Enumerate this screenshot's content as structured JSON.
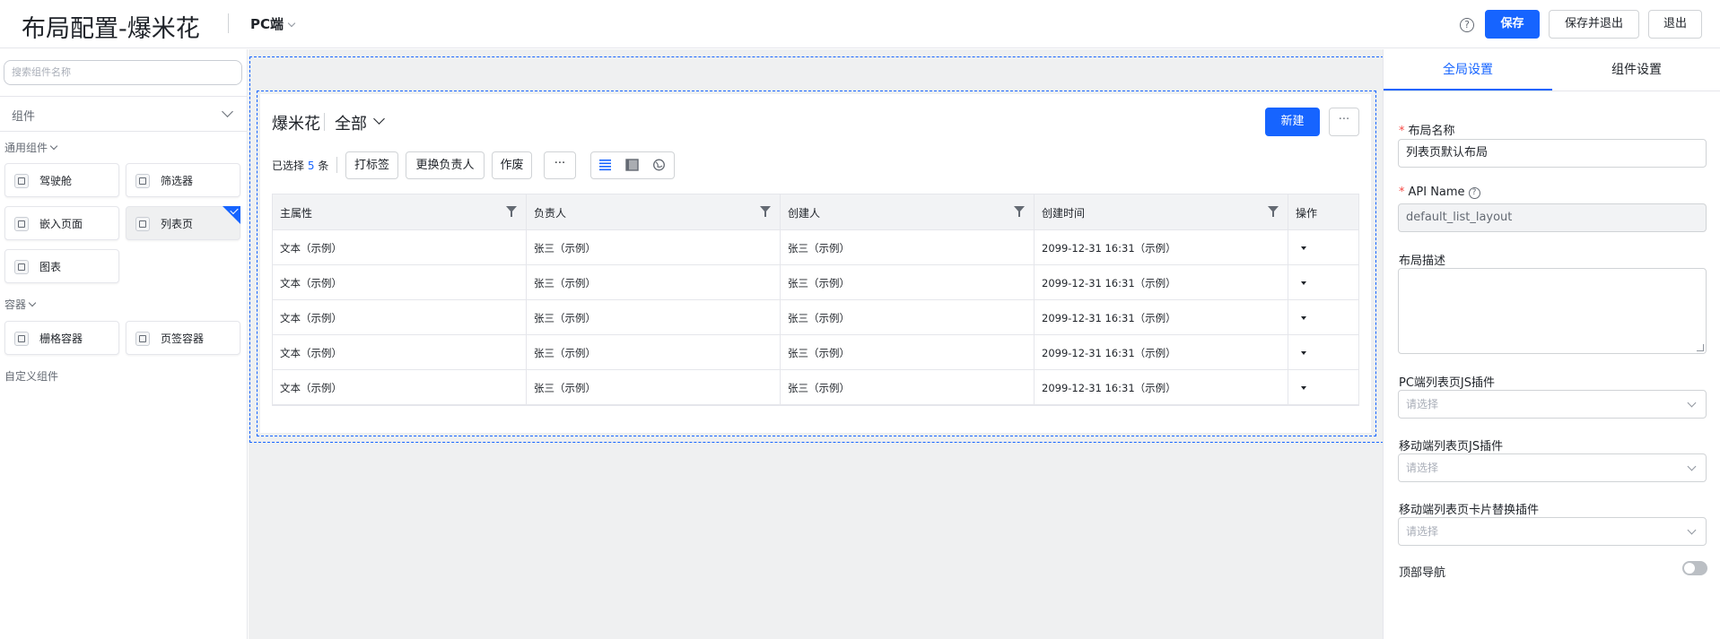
{
  "header": {
    "title": "布局配置-爆米花",
    "device": "PC端",
    "help_icon": "?",
    "save": "保存",
    "save_exit": "保存并退出",
    "exit": "退出"
  },
  "left": {
    "search_placeholder": "搜索组件名称",
    "category_select": "组件",
    "sections": {
      "common": "通用组件",
      "container": "容器",
      "custom": "自定义组件"
    },
    "common_items": [
      "驾驶舱",
      "筛选器",
      "嵌入页面",
      "列表页",
      "图表"
    ],
    "container_items": [
      "栅格容器",
      "页签容器"
    ]
  },
  "canvas": {
    "title": "爆米花",
    "view": "全部",
    "new_button": "新建",
    "more_button": "···",
    "selected_prefix": "已选择",
    "selected_count": "5",
    "selected_suffix": "条",
    "actions": [
      "打标签",
      "更换负责人",
      "作废"
    ],
    "actions_more": "···",
    "columns": [
      "主属性",
      "负责人",
      "创建人",
      "创建时间",
      "操作"
    ],
    "rows": [
      [
        "文本（示例）",
        "张三（示例）",
        "张三（示例）",
        "2099-12-31 16:31（示例）"
      ],
      [
        "文本（示例）",
        "张三（示例）",
        "张三（示例）",
        "2099-12-31 16:31（示例）"
      ],
      [
        "文本（示例）",
        "张三（示例）",
        "张三（示例）",
        "2099-12-31 16:31（示例）"
      ],
      [
        "文本（示例）",
        "张三（示例）",
        "张三（示例）",
        "2099-12-31 16:31（示例）"
      ],
      [
        "文本（示例）",
        "张三（示例）",
        "张三（示例）",
        "2099-12-31 16:31（示例）"
      ]
    ]
  },
  "right": {
    "tabs": [
      "全局设置",
      "组件设置"
    ],
    "fields": {
      "layout_name_label": "布局名称",
      "layout_name_value": "列表页默认布局",
      "api_name_label": "API Name",
      "api_name_value": "default_list_layout",
      "desc_label": "布局描述",
      "pc_plugin_label": "PC端列表页JS插件",
      "mobile_plugin_label": "移动端列表页JS插件",
      "mobile_card_label": "移动端列表页卡片替换插件",
      "select_placeholder": "请选择",
      "top_nav_label": "顶部导航"
    },
    "required_mark": "*"
  },
  "colors": {
    "primary": "#1664ff",
    "canvas_bg": "#eff0f1",
    "border": "#e5e6eb"
  }
}
